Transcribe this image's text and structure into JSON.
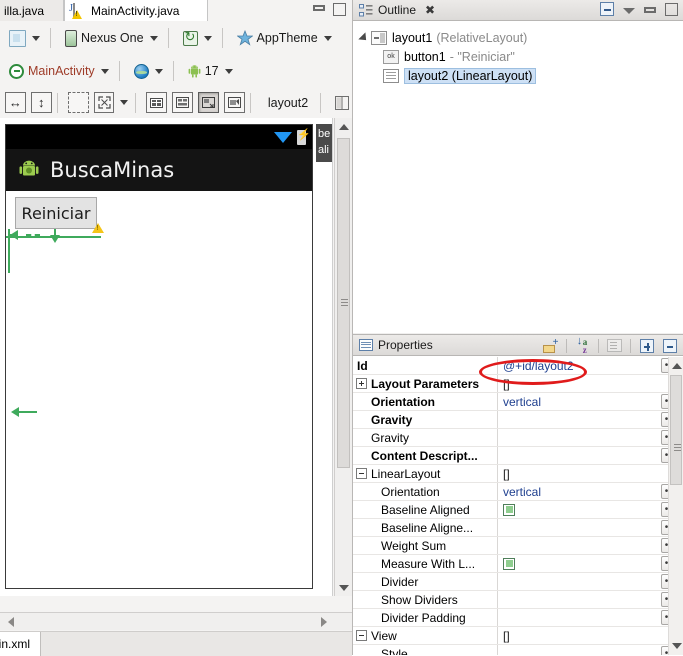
{
  "editor": {
    "tabs": [
      {
        "label": "illa.java",
        "icon": "java-file-icon",
        "active": false,
        "clipped": true
      },
      {
        "label": "MainActivity.java",
        "icon": "java-file-warning-icon",
        "active": true,
        "clipped": false
      }
    ],
    "window_controls": {
      "minimize": "minimize-icon",
      "maximize": "maximize-icon"
    },
    "toolbar_row1": {
      "config_label": "",
      "device_label": "Nexus One",
      "orientation_label": "",
      "theme_label": "AppTheme"
    },
    "toolbar_row2": {
      "activity_label": "MainActivity",
      "locale_label": "",
      "api_label": "17"
    },
    "toolbar_row3": {
      "selection_label": "layout2"
    }
  },
  "preview": {
    "app_title": "BuscaMinas",
    "button_label": "Reiniciar",
    "tooltip_lines": [
      "be",
      "ali"
    ],
    "status_icons": [
      "wifi-signal-icon",
      "battery-charging-icon"
    ]
  },
  "bottom_tab": {
    "label": "ain.xml"
  },
  "outline": {
    "title": "Outline",
    "close_label": "✖",
    "toolbar": [
      "collapse-all-icon",
      "view-menu-icon",
      "minimize-icon",
      "maximize-icon"
    ],
    "tree": [
      {
        "name": "layout1",
        "type": "(RelativeLayout)",
        "icon": "relativelayout-icon",
        "indent": 0,
        "selected": false,
        "expanded": true
      },
      {
        "name": "button1",
        "type": "- \"Reiniciar\"",
        "icon": "button-warning-icon",
        "indent": 1,
        "selected": false,
        "expanded": false
      },
      {
        "name": "layout2 (LinearLayout)",
        "type": "",
        "icon": "linearlayout-icon",
        "indent": 1,
        "selected": true,
        "expanded": false
      }
    ],
    "highlight_color": "#e01b1b"
  },
  "properties": {
    "title": "Properties",
    "toolbar": [
      "show-advanced-icon",
      "sort-alphabetically-icon",
      "filter-icon",
      "expand-all-icon",
      "collapse-all-icon"
    ],
    "rows": [
      {
        "name": "Id",
        "value": "@+id/layout2",
        "bold": true,
        "indent": 0,
        "valueStyle": "link",
        "dots": true,
        "highlight": true
      },
      {
        "name": "Layout Parameters",
        "value": "[]",
        "bold": true,
        "indent": 0,
        "valueStyle": "plain",
        "dots": false,
        "expander": "plus"
      },
      {
        "name": "Orientation",
        "value": "vertical",
        "bold": true,
        "indent": 1,
        "valueStyle": "link",
        "dots": true
      },
      {
        "name": "Gravity",
        "value": "",
        "bold": true,
        "indent": 1,
        "valueStyle": "plain",
        "dots": true
      },
      {
        "name": "Gravity",
        "value": "",
        "bold": false,
        "indent": 1,
        "valueStyle": "plain",
        "dots": true
      },
      {
        "name": "Content Descript...",
        "value": "",
        "bold": true,
        "indent": 1,
        "valueStyle": "plain",
        "dots": true
      },
      {
        "name": "LinearLayout",
        "value": "[]",
        "bold": false,
        "indent": 0,
        "valueStyle": "plain",
        "dots": false,
        "expander": "minus"
      },
      {
        "name": "Orientation",
        "value": "vertical",
        "bold": false,
        "indent": 2,
        "valueStyle": "link",
        "dots": true
      },
      {
        "name": "Baseline Aligned",
        "value": "",
        "bold": false,
        "indent": 2,
        "valueStyle": "check",
        "dots": true
      },
      {
        "name": "Baseline Aligne...",
        "value": "",
        "bold": false,
        "indent": 2,
        "valueStyle": "plain",
        "dots": true
      },
      {
        "name": "Weight Sum",
        "value": "",
        "bold": false,
        "indent": 2,
        "valueStyle": "plain",
        "dots": true
      },
      {
        "name": "Measure With L...",
        "value": "",
        "bold": false,
        "indent": 2,
        "valueStyle": "check",
        "dots": true
      },
      {
        "name": "Divider",
        "value": "",
        "bold": false,
        "indent": 2,
        "valueStyle": "plain",
        "dots": true
      },
      {
        "name": "Show Dividers",
        "value": "",
        "bold": false,
        "indent": 2,
        "valueStyle": "plain",
        "dots": true
      },
      {
        "name": "Divider Padding",
        "value": "",
        "bold": false,
        "indent": 2,
        "valueStyle": "plain",
        "dots": true
      },
      {
        "name": "View",
        "value": "[]",
        "bold": false,
        "indent": 0,
        "valueStyle": "plain",
        "dots": false,
        "expander": "minus"
      },
      {
        "name": "Style",
        "value": "",
        "bold": false,
        "indent": 2,
        "valueStyle": "plain",
        "dots": true
      }
    ]
  }
}
